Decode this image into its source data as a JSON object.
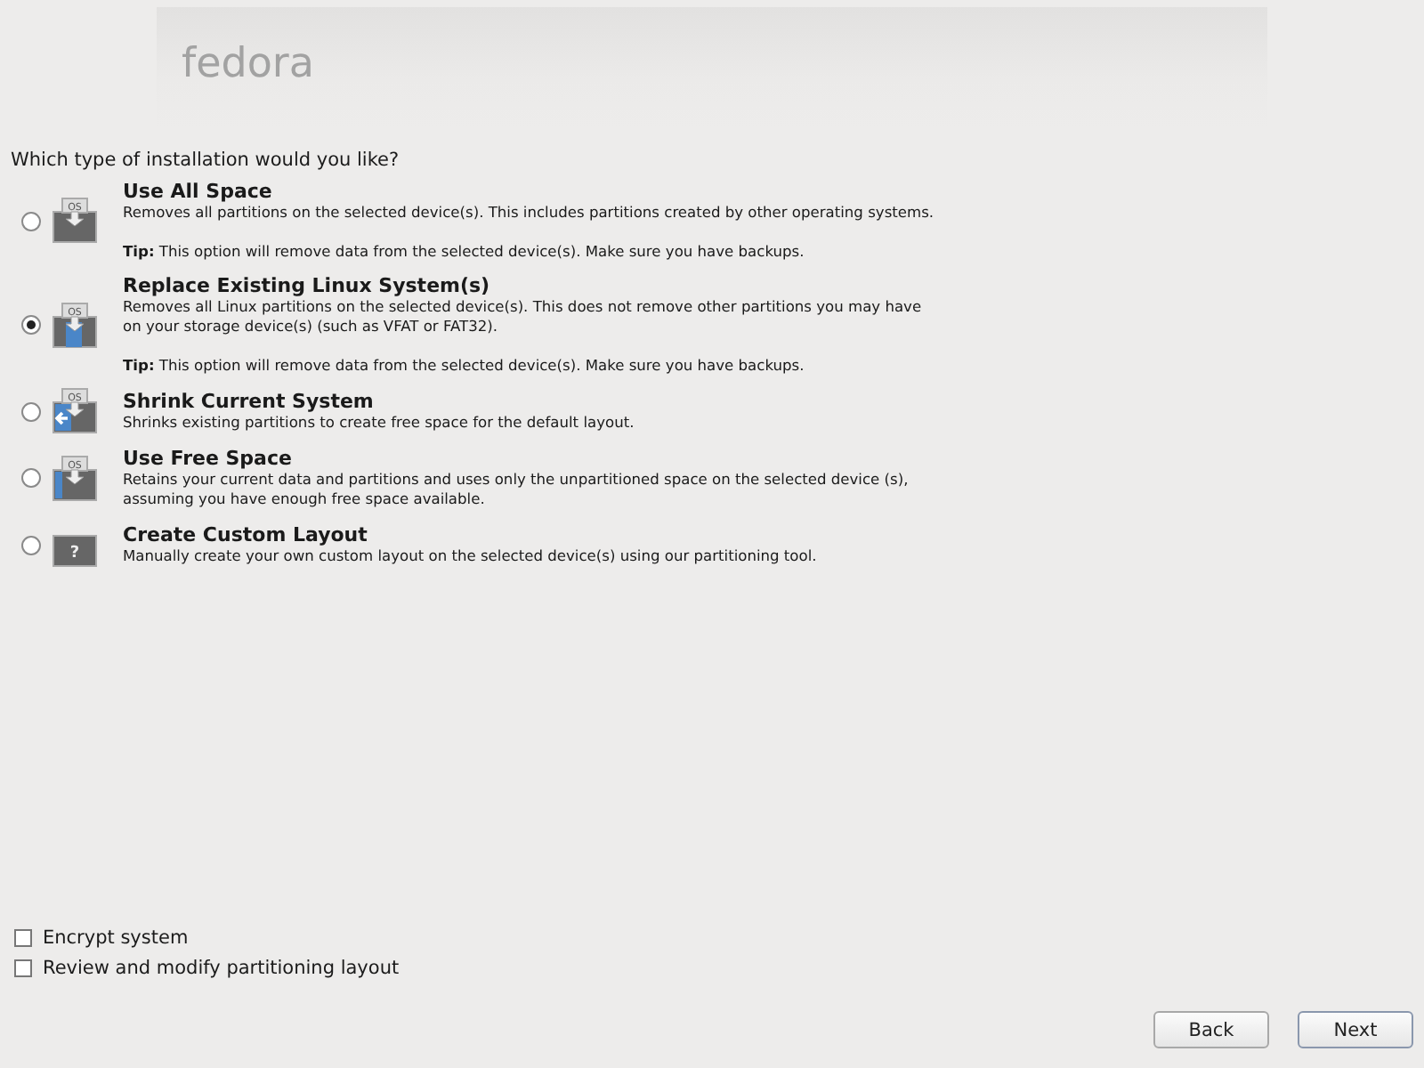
{
  "header": {
    "logo": "fedora"
  },
  "question": "Which type of installation would you like?",
  "options": [
    {
      "kind": "all",
      "icon_label": "OS",
      "title": "Use All Space",
      "description": "Removes all partitions on the selected device(s).  This includes partitions created by other operating systems.",
      "tip": "**Tip:** This option will remove data from the selected device(s).  Make sure you have backups.",
      "selected": false
    },
    {
      "kind": "replace",
      "icon_label": "OS",
      "title": "Replace Existing Linux System(s)",
      "description": "Removes all Linux partitions on the selected device(s). This does not remove other partitions you may have on your storage device(s) (such as VFAT or FAT32).",
      "tip": "**Tip:** This option will remove data from the selected device(s).  Make sure you have backups.",
      "selected": true
    },
    {
      "kind": "shrink",
      "icon_label": "OS",
      "title": "Shrink Current System",
      "description": "Shrinks existing partitions to create free space for the default layout.",
      "selected": false
    },
    {
      "kind": "free",
      "icon_label": "OS",
      "title": "Use Free Space",
      "description": "Retains your current data and partitions and uses only the unpartitioned space on the selected device (s), assuming you have enough free space available.",
      "selected": false
    },
    {
      "kind": "custom",
      "icon_label": "?",
      "title": "Create Custom Layout",
      "description": "Manually create your own custom layout on the selected device(s) using our partitioning tool.",
      "selected": false
    }
  ],
  "checkboxes": [
    {
      "label": "Encrypt system",
      "checked": false
    },
    {
      "label": "Review and modify partitioning layout",
      "checked": false
    }
  ],
  "buttons": [
    {
      "label": "Back",
      "default": false
    },
    {
      "label": "Next",
      "default": true
    }
  ]
}
